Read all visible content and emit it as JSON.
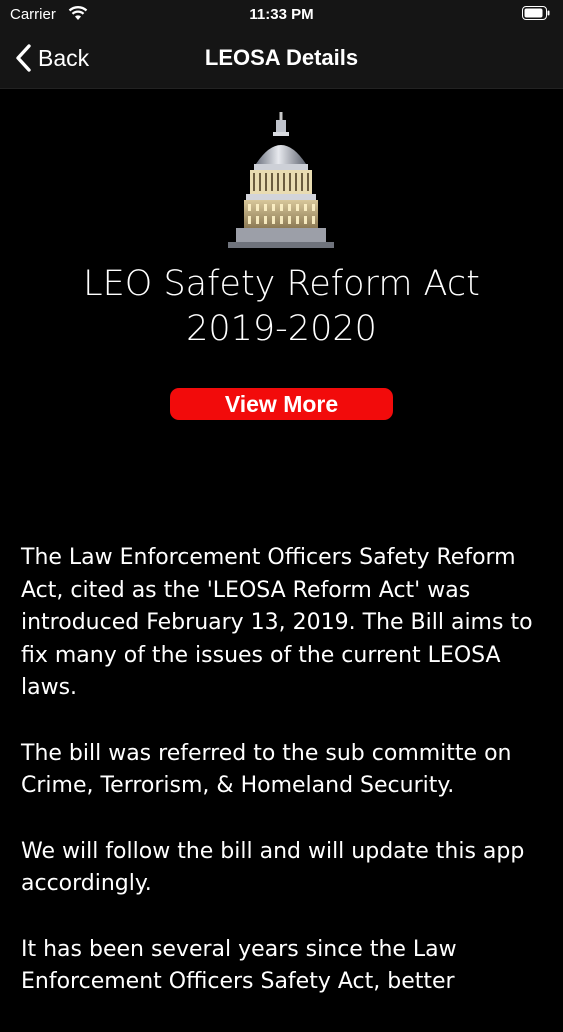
{
  "status_bar": {
    "carrier": "Carrier",
    "time": "11:33 PM"
  },
  "nav": {
    "back_label": "Back",
    "title": "LEOSA Details"
  },
  "hero": {
    "title_line1": "LEO Safety Reform Act",
    "title_line2": "2019-2020",
    "view_more_label": "View More"
  },
  "body": {
    "paragraphs": [
      "The Law Enforcement Officers Safety Reform Act, cited as the 'LEOSA Reform Act' was introduced February 13, 2019. The Bill aims to fix many of the issues of the current LEOSA laws.",
      "The bill was referred to the sub committe on Crime, Terrorism, & Homeland Security.",
      "We will follow the bill and will update this app accordingly.",
      "It has been several years since the Law Enforcement Officers Safety Act, better"
    ]
  },
  "colors": {
    "button": "#f20b0b",
    "background": "#000000",
    "bar": "#151515"
  },
  "icons": [
    "wifi-icon",
    "battery-icon",
    "back-chevron-icon",
    "capitol-dome-image"
  ]
}
